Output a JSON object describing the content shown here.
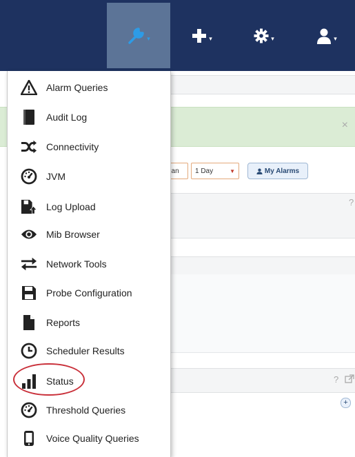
{
  "nav": {
    "tools_caret": "▾",
    "add_caret": "▾",
    "settings_caret": "▾",
    "user_caret": "▾",
    "accent_active": "#5c7497",
    "bar_color": "#1e3260"
  },
  "background": {
    "filter_partial_label": "han",
    "filter_day_label": "1 Day",
    "filter_day_caret": "▼",
    "my_alarms_label": "My Alarms",
    "close_symbol": "×",
    "help_symbol": "?",
    "help_symbol_2": "? ",
    "add_symbol": "+"
  },
  "menu": {
    "items": [
      {
        "label": "Alarm Queries",
        "icon": "warning-icon"
      },
      {
        "label": "Audit Log",
        "icon": "book-icon"
      },
      {
        "label": "Connectivity",
        "icon": "random-icon"
      },
      {
        "label": "JVM",
        "icon": "dashboard-icon"
      },
      {
        "label": "Log Upload",
        "icon": "file-upload-icon"
      },
      {
        "label": "Mib Browser",
        "icon": "eye-icon"
      },
      {
        "label": "Network Tools",
        "icon": "exchange-icon"
      },
      {
        "label": "Probe Configuration",
        "icon": "save-icon"
      },
      {
        "label": "Reports",
        "icon": "file-icon"
      },
      {
        "label": "Scheduler Results",
        "icon": "clock-icon"
      },
      {
        "label": "Status",
        "icon": "bar-chart-icon"
      },
      {
        "label": "Threshold Queries",
        "icon": "dashboard-icon"
      },
      {
        "label": "Voice Quality Queries",
        "icon": "mobile-icon"
      }
    ],
    "highlighted": "Status",
    "highlight_color": "#c9303a"
  }
}
